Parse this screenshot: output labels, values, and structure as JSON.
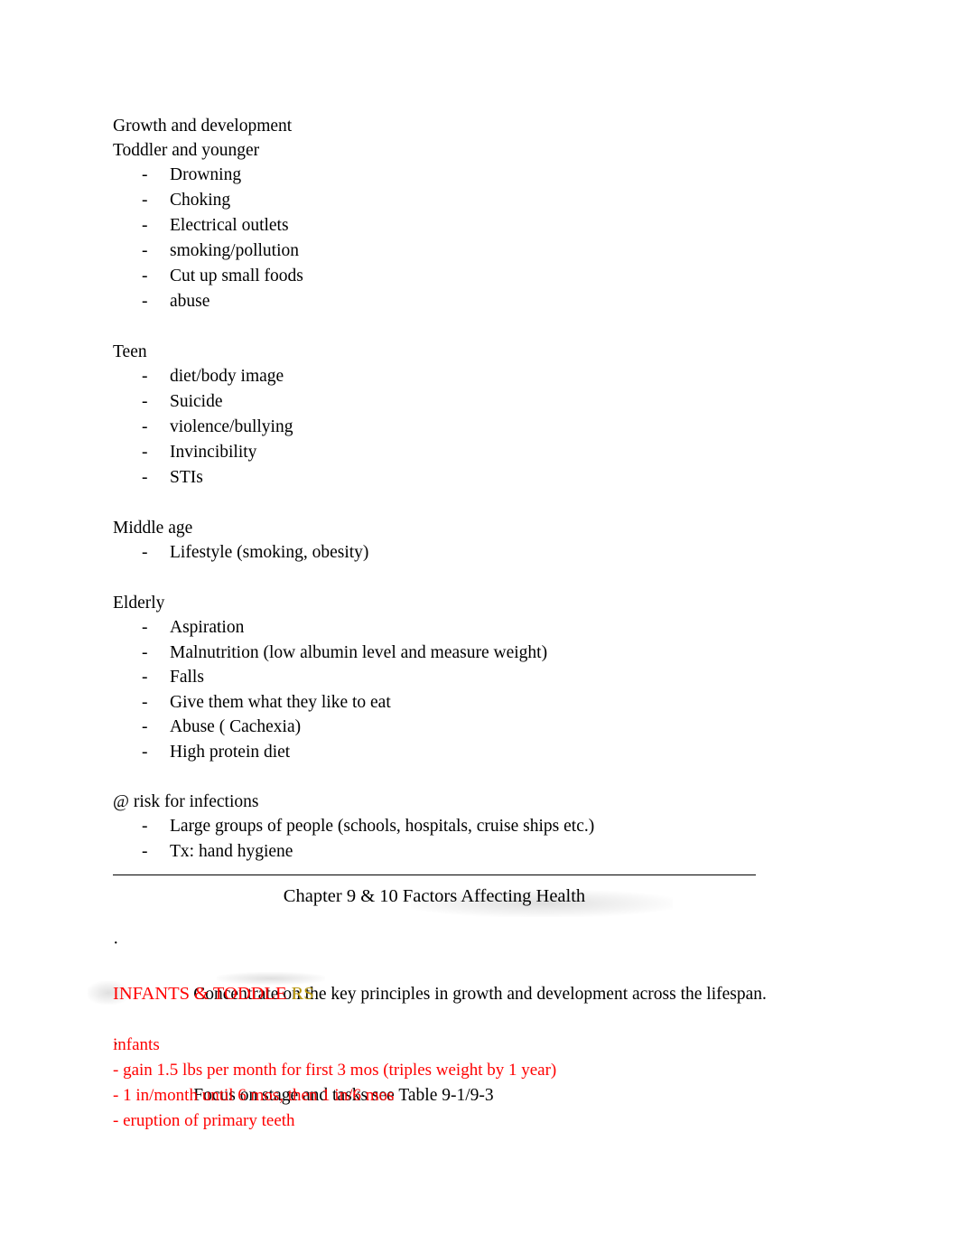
{
  "document": {
    "sections": [
      {
        "id": "growth-and-development",
        "heading_lines": [
          "Growth and development",
          "Toddler and younger"
        ],
        "items": [
          "Drowning",
          "Choking",
          "Electrical outlets",
          "smoking/pollution",
          "Cut up small foods",
          "abuse"
        ]
      },
      {
        "id": "teen",
        "heading_lines": [
          "Teen"
        ],
        "items": [
          "diet/body image",
          "Suicide",
          "violence/bullying",
          "Invincibility",
          "STIs"
        ]
      },
      {
        "id": "middle-age",
        "heading_lines": [
          "Middle age"
        ],
        "items": [
          "Lifestyle (smoking, obesity)"
        ]
      },
      {
        "id": "elderly",
        "heading_lines": [
          "Elderly"
        ],
        "items": [
          "Aspiration",
          "Malnutrition (low albumin level and measure weight)",
          "Falls",
          "Give them what they like to eat",
          "Abuse ( Cachexia)",
          "High protein diet"
        ]
      },
      {
        "id": "risk-for-infections",
        "heading_lines": [
          "@ risk for infections"
        ],
        "items": [
          "Large groups of people (schools, hospitals, cruise ships etc.)",
          "Tx: hand hygiene"
        ]
      }
    ],
    "bullet_dash": "-",
    "bullet_middot": "·"
  },
  "chapter": {
    "title": "Chapter 9 & 10 Factors Affecting Health",
    "key_points": [
      "Concentrate on the key principles in growth and development across the lifespan.",
      "Focus on stage and tasks see Table 9-1/9-3"
    ]
  },
  "infants_note": {
    "title_red": "INFANTS & TODDLE",
    "title_gold": "RS",
    "subtitle": "infants",
    "lines": [
      "- gain 1.5 lbs per month for first 3 mos (triples weight by 1 year)",
      "- 1 in/month until 6 mos, then 1 in/6 mos",
      "- eruption of primary teeth"
    ]
  },
  "colors": {
    "text": "#000000",
    "red": "#FF0000",
    "gold": "#B8960C",
    "rule": "#000000"
  }
}
